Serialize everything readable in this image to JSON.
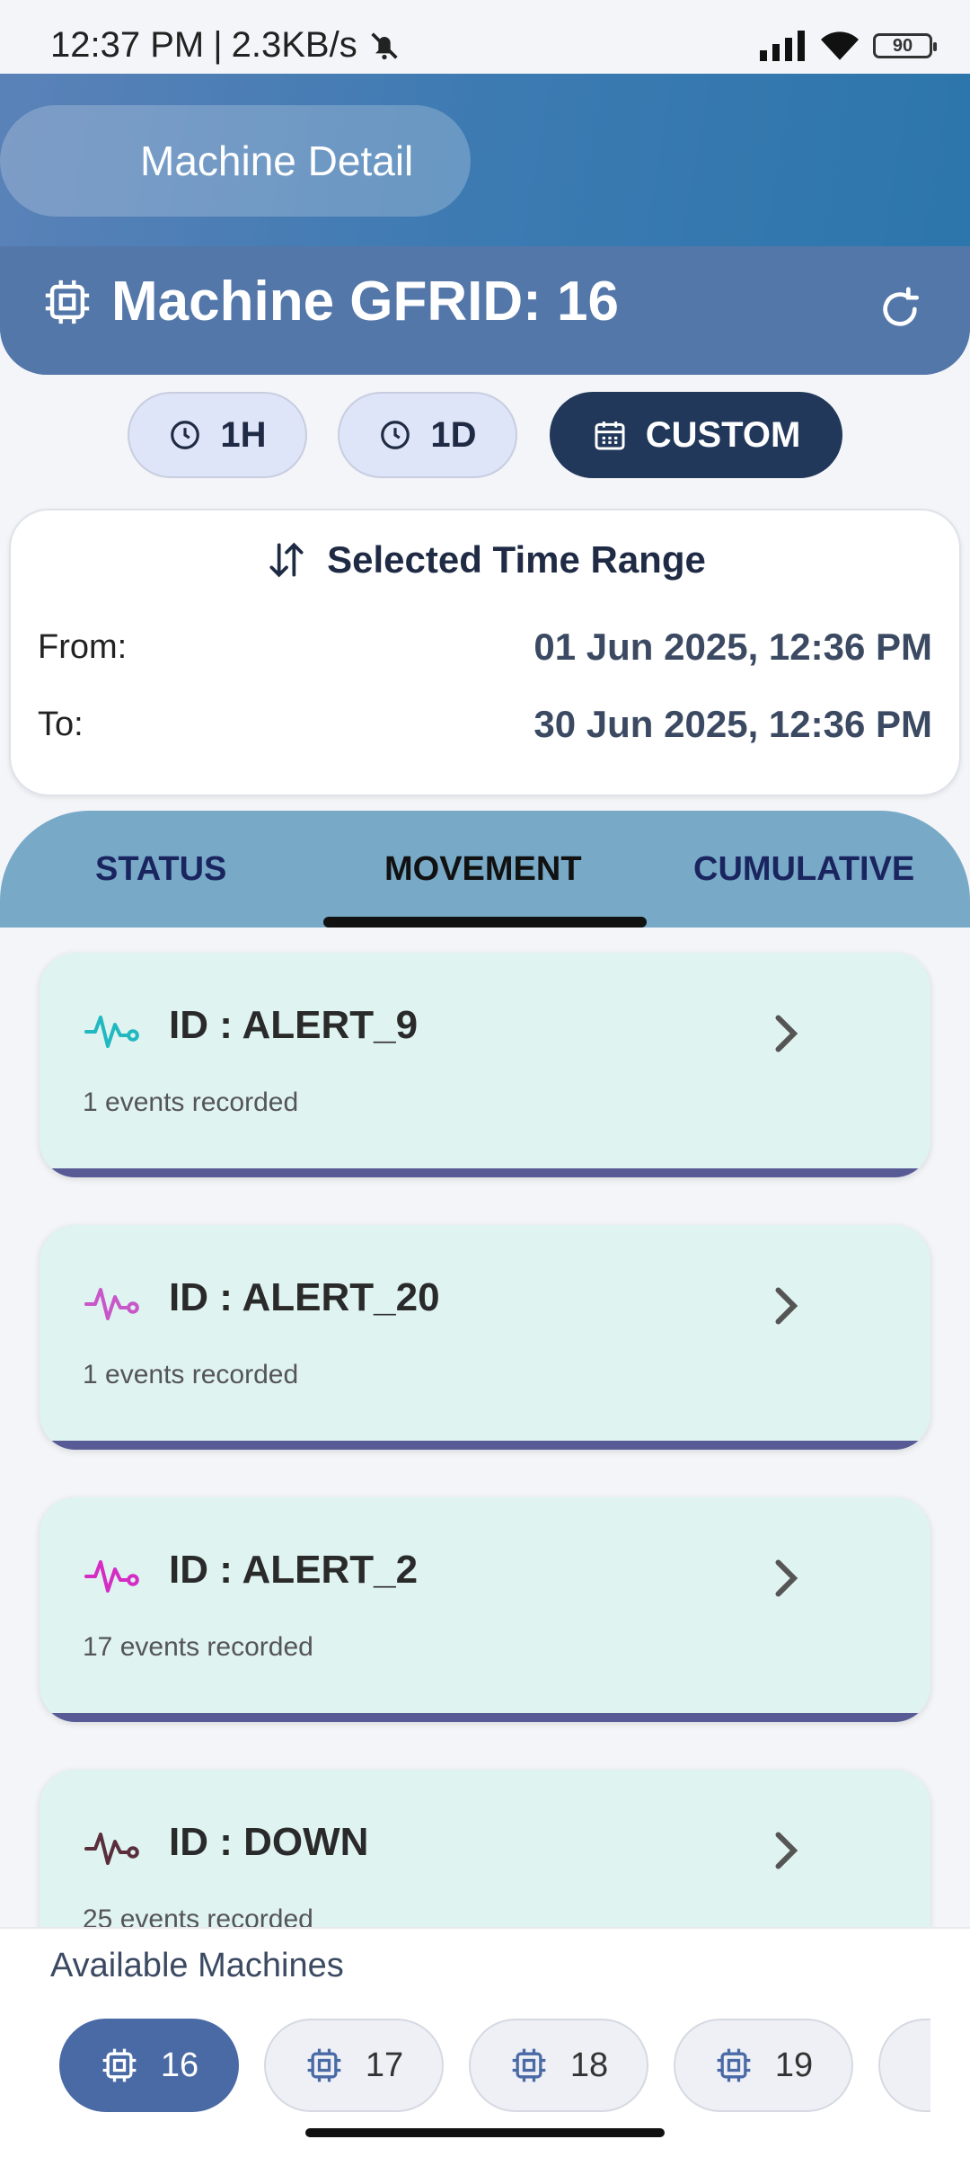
{
  "status_bar": {
    "time": "12:37 PM",
    "net_speed": "2.3KB/s",
    "battery": "90"
  },
  "header": {
    "title": "Machine Detail",
    "machine_label": "Machine GFRID: 16"
  },
  "range_buttons": [
    {
      "label": "1H"
    },
    {
      "label": "1D"
    },
    {
      "label": "CUSTOM"
    }
  ],
  "time_range": {
    "heading": "Selected Time Range",
    "from_label": "From:",
    "from_value": "01 Jun 2025, 12:36 PM",
    "to_label": "To:",
    "to_value": "30 Jun 2025, 12:36 PM"
  },
  "tabs": [
    {
      "label": "STATUS"
    },
    {
      "label": "MOVEMENT"
    },
    {
      "label": "CUMULATIVE"
    }
  ],
  "alerts": [
    {
      "id": "ID : ALERT_9",
      "events": "1 events recorded",
      "icon": "pulse-icon",
      "color": "#21b8c0"
    },
    {
      "id": "ID : ALERT_20",
      "events": "1 events recorded",
      "icon": "pulse-icon",
      "color": "#c857c8"
    },
    {
      "id": "ID : ALERT_2",
      "events": "17 events recorded",
      "icon": "pulse-icon",
      "color": "#d52cc4"
    },
    {
      "id": "ID : DOWN",
      "events": "25 events recorded",
      "icon": "pulse-icon",
      "color": "#5a2f3b"
    }
  ],
  "machines": {
    "title": "Available Machines",
    "items": [
      {
        "label": "16"
      },
      {
        "label": "17"
      },
      {
        "label": "18"
      },
      {
        "label": "19"
      },
      {
        "label": ""
      }
    ]
  }
}
